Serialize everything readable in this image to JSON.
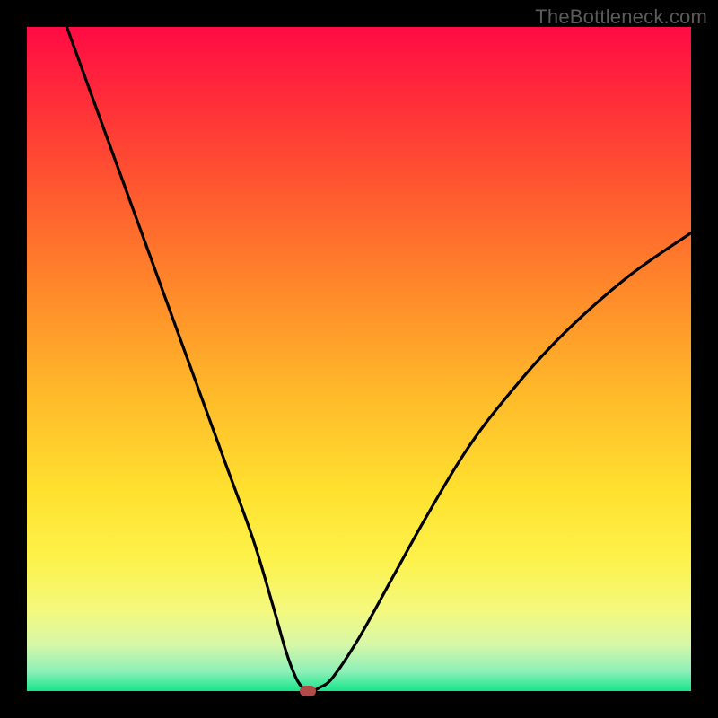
{
  "watermark": "TheBottleneck.com",
  "chart_data": {
    "type": "line",
    "title": "",
    "xlabel": "",
    "ylabel": "",
    "xlim": [
      0,
      100
    ],
    "ylim": [
      0,
      100
    ],
    "grid": false,
    "legend": false,
    "gradient_stops": [
      {
        "pos": 0.0,
        "color": "#ff0b44"
      },
      {
        "pos": 0.1,
        "color": "#ff2a3a"
      },
      {
        "pos": 0.25,
        "color": "#ff5a2f"
      },
      {
        "pos": 0.4,
        "color": "#ff8a2a"
      },
      {
        "pos": 0.55,
        "color": "#ffb92a"
      },
      {
        "pos": 0.7,
        "color": "#ffe12f"
      },
      {
        "pos": 0.8,
        "color": "#fdf24a"
      },
      {
        "pos": 0.88,
        "color": "#f4f97f"
      },
      {
        "pos": 0.93,
        "color": "#d7f7a8"
      },
      {
        "pos": 0.97,
        "color": "#8ef0b8"
      },
      {
        "pos": 1.0,
        "color": "#17e58a"
      }
    ],
    "series": [
      {
        "name": "bottleneck-curve",
        "x": [
          6,
          10,
          14,
          18,
          22,
          26,
          30,
          34,
          37,
          39,
          40.5,
          41.5,
          42,
          43,
          44,
          46,
          50,
          55,
          60,
          66,
          72,
          80,
          90,
          100
        ],
        "y": [
          100,
          89,
          78,
          67,
          56,
          45,
          34,
          23,
          13,
          6,
          2,
          0.5,
          0,
          0,
          0.5,
          2,
          8,
          17,
          26,
          36,
          44,
          53,
          62,
          69
        ]
      }
    ],
    "flat_bottom": {
      "x_start": 40.5,
      "x_end": 44,
      "y": 0
    },
    "marker": {
      "x": 42.3,
      "y": 0
    }
  }
}
